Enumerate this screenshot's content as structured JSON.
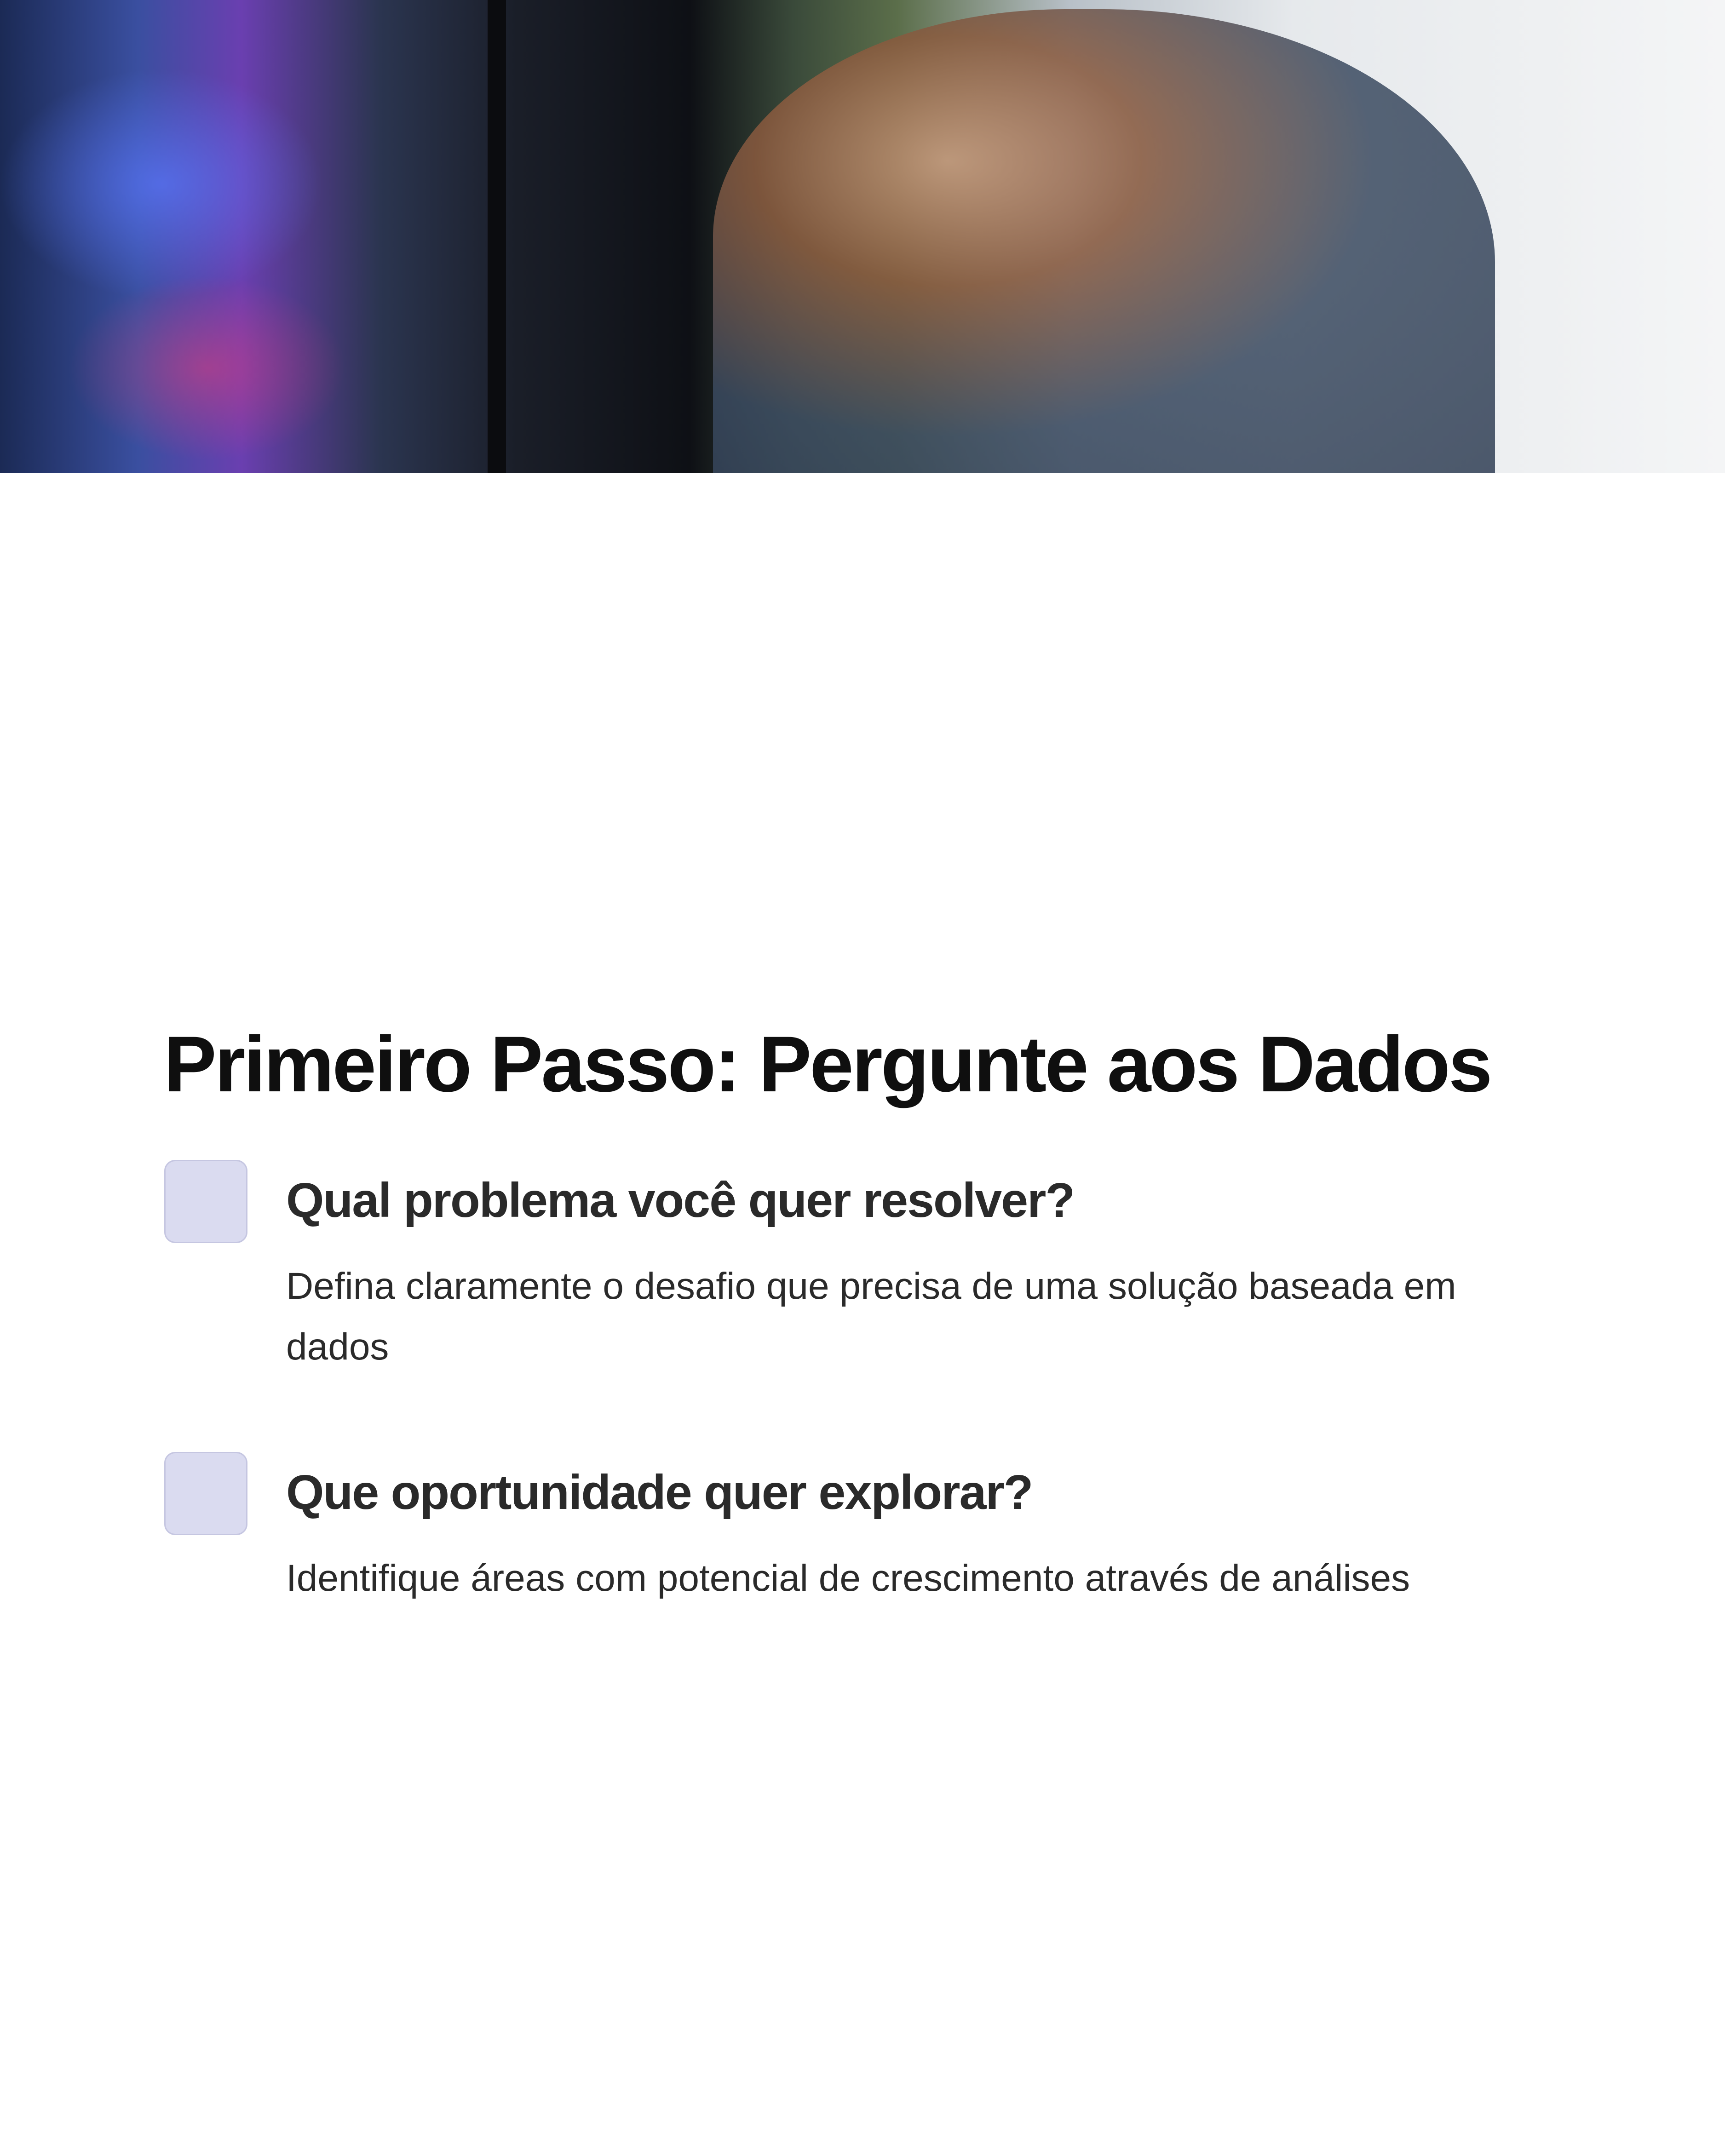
{
  "hero_image": {
    "description_icon": "hero-photo"
  },
  "title": "Primeiro Passo: Pergunte aos Dados",
  "items": [
    {
      "heading": "Qual problema você quer resolver?",
      "text": "Defina claramente o desafio que precisa de uma solução baseada em dados"
    },
    {
      "heading": "Que oportunidade quer explorar?",
      "text": "Identifique áreas com potencial de crescimento através de análises"
    }
  ],
  "colors": {
    "box": "#dadbf0",
    "box_border": "#c5c6e1",
    "text": "#2a2a2a"
  }
}
